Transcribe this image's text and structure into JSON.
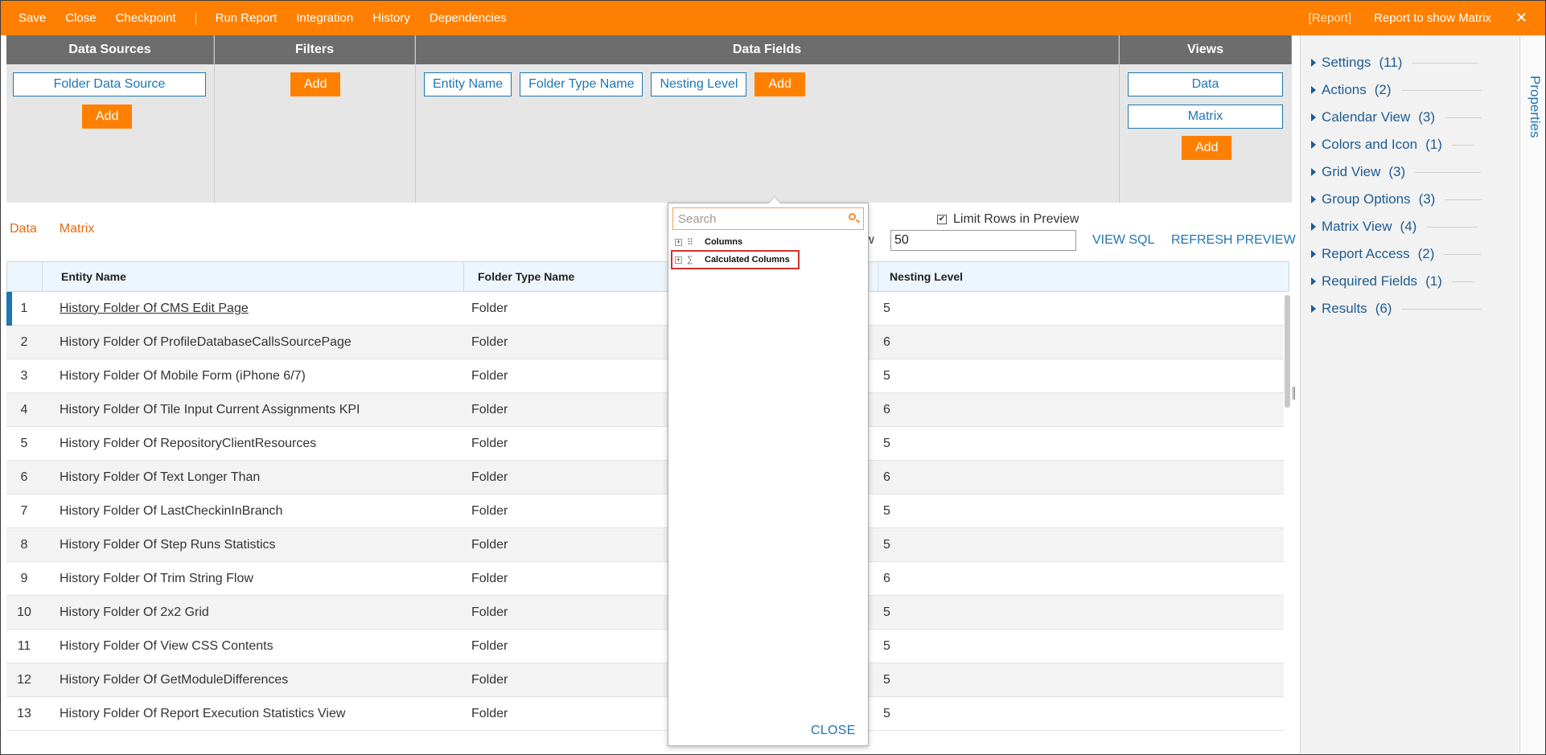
{
  "topbar": {
    "menu": [
      "Save",
      "Close",
      "Checkpoint",
      "Run Report",
      "Integration",
      "History",
      "Dependencies"
    ],
    "report_tag": "[Report]",
    "report_title": "Report to show Matrix",
    "close_glyph": "✕"
  },
  "designer": {
    "data_sources": {
      "header": "Data Sources",
      "items": [
        "Folder Data Source"
      ],
      "add": "Add"
    },
    "filters": {
      "header": "Filters",
      "add": "Add"
    },
    "data_fields": {
      "header": "Data Fields",
      "items": [
        "Entity Name",
        "Folder Type Name",
        "Nesting Level"
      ],
      "add": "Add"
    },
    "views": {
      "header": "Views",
      "items": [
        "Data",
        "Matrix"
      ],
      "add": "Add"
    }
  },
  "preview": {
    "tabs": [
      "Data",
      "Matrix"
    ],
    "limit_label": "Limit Rows in Preview",
    "limit_checked": true,
    "rows_label_fragment": "w",
    "rows_value": "50",
    "view_sql": "VIEW SQL",
    "refresh": "REFRESH PREVIEW"
  },
  "grid": {
    "columns": [
      "Entity Name",
      "Folder Type Name",
      "Nesting Level"
    ],
    "rows": [
      {
        "n": "1",
        "name": "History Folder Of CMS Edit Page",
        "type": "Folder",
        "level": "5"
      },
      {
        "n": "2",
        "name": "History Folder Of ProfileDatabaseCallsSourcePage",
        "type": "Folder",
        "level": "6"
      },
      {
        "n": "3",
        "name": "History Folder Of Mobile Form (iPhone 6/7)",
        "type": "Folder",
        "level": "5"
      },
      {
        "n": "4",
        "name": "History Folder Of Tile Input Current Assignments KPI",
        "type": "Folder",
        "level": "6"
      },
      {
        "n": "5",
        "name": "History Folder Of RepositoryClientResources",
        "type": "Folder",
        "level": "5"
      },
      {
        "n": "6",
        "name": "History Folder Of Text Longer Than",
        "type": "Folder",
        "level": "6"
      },
      {
        "n": "7",
        "name": "History Folder Of LastCheckinInBranch",
        "type": "Folder",
        "level": "5"
      },
      {
        "n": "8",
        "name": "History Folder Of Step Runs Statistics",
        "type": "Folder",
        "level": "5"
      },
      {
        "n": "9",
        "name": "History Folder Of Trim String Flow",
        "type": "Folder",
        "level": "6"
      },
      {
        "n": "10",
        "name": "History Folder Of 2x2 Grid",
        "type": "Folder",
        "level": "5"
      },
      {
        "n": "11",
        "name": "History Folder Of View CSS Contents",
        "type": "Folder",
        "level": "5"
      },
      {
        "n": "12",
        "name": "History Folder Of GetModuleDifferences",
        "type": "Folder",
        "level": "5"
      },
      {
        "n": "13",
        "name": "History Folder Of Report Execution Statistics View",
        "type": "Folder",
        "level": "5"
      }
    ]
  },
  "properties": {
    "tab_label": "Properties",
    "items": [
      {
        "label": "Settings",
        "count": "(11)"
      },
      {
        "label": "Actions",
        "count": "(2)"
      },
      {
        "label": "Calendar View",
        "count": "(3)"
      },
      {
        "label": "Colors and Icon",
        "count": "(1)"
      },
      {
        "label": "Grid View",
        "count": "(3)"
      },
      {
        "label": "Group Options",
        "count": "(3)"
      },
      {
        "label": "Matrix View",
        "count": "(4)"
      },
      {
        "label": "Report Access",
        "count": "(2)"
      },
      {
        "label": "Required Fields",
        "count": "(1)"
      },
      {
        "label": "Results",
        "count": "(6)"
      }
    ]
  },
  "popup": {
    "search_placeholder": "Search",
    "nodes": [
      {
        "label": "Columns",
        "icon": "grid-dots-icon",
        "glyph": "⠿"
      },
      {
        "label": "Calculated Columns",
        "icon": "sigma-icon",
        "glyph": "∑"
      }
    ],
    "expand_glyph": "+",
    "close": "CLOSE"
  },
  "colors": {
    "accent": "#ff8000",
    "link": "#1d76b3",
    "highlight": "#d32f2f"
  }
}
